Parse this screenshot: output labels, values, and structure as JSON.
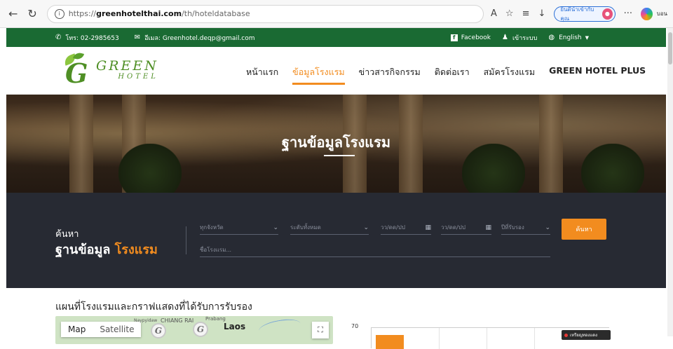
{
  "browser": {
    "url_proto": "https://",
    "url_host": "greenhotelthai.com",
    "url_path": "/th/hoteldatabase",
    "sync_label": "ยินดีนำเข้ากับคุณ",
    "profile_tail": "บอน"
  },
  "topbar": {
    "phone": "โทร: 02-2985653",
    "email": "อีเมล: Greenhotel.deqp@gmail.com",
    "facebook": "Facebook",
    "login": "เข้าระบบ",
    "language": "English"
  },
  "logo": {
    "line1": "GREEN",
    "line2": "HOTEL",
    "g": "G"
  },
  "nav": {
    "items": [
      {
        "label": "หน้าแรก",
        "active": false
      },
      {
        "label": "ข้อมูลโรงแรม",
        "active": true
      },
      {
        "label": "ข่าวสารกิจกรรม",
        "active": false
      },
      {
        "label": "ติดต่อเรา",
        "active": false
      },
      {
        "label": "สมัครโรงแรม",
        "active": false
      },
      {
        "label": "GREEN HOTEL PLUS",
        "active": false
      }
    ]
  },
  "hero": {
    "title": "ฐานข้อมูลโรงแรม"
  },
  "search": {
    "caption": "ค้นหา",
    "title_main": "ฐานข้อมูล ",
    "title_accent": "โรงแรม",
    "province": "ทุกจังหวัด",
    "level": "ระดับทั้งหมด",
    "date_from": "วว/ดด/ปป",
    "date_to": "วว/ดด/ปป",
    "year": "ปีที่รับรอง",
    "hotel_name": "ชื่อโรงแรม...",
    "button": "ค้นหา"
  },
  "lower": {
    "section_title": "แผนที่โรงแรมและกราฟแสดงที่ได้รับการรับรอง",
    "map_tab_map": "Map",
    "map_tab_satellite": "Satellite",
    "map_label_laos": "Laos",
    "map_label_chiang": "CHIANG RAI",
    "map_label_prabang": "Prabang",
    "map_label_naypyidaw": "Naypyidaw",
    "chart_ytick": "70",
    "legend_label": "เหรียญทองแดง"
  },
  "colors": {
    "green": "#1a6a33",
    "orange": "#f28c1f",
    "dark": "#272a33"
  }
}
